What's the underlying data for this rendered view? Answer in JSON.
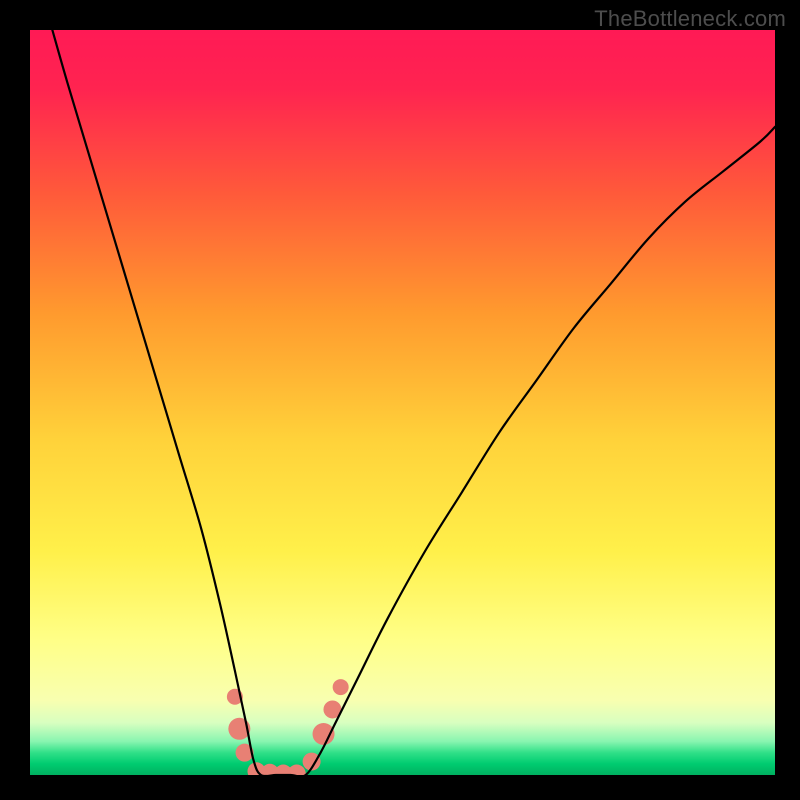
{
  "watermark": "TheBottleneck.com",
  "chart_data": {
    "type": "line",
    "title": "",
    "xlabel": "",
    "ylabel": "",
    "xlim": [
      0,
      1
    ],
    "ylim": [
      0,
      1
    ],
    "background_gradient": {
      "top": "#ff1a4d",
      "upper_mid": "#ff8a2a",
      "mid": "#ffe03a",
      "lower_mid": "#ffff80",
      "green_band": "#00e673",
      "bottom": "#00b359"
    },
    "curve": {
      "description": "Smooth V-shaped bottleneck curve. Falls steeply from top-left, reaches zero around x≈0.30–0.36, rises gently and then steeply toward upper right.",
      "x": [
        0.03,
        0.05,
        0.08,
        0.11,
        0.14,
        0.17,
        0.2,
        0.23,
        0.255,
        0.275,
        0.29,
        0.3,
        0.31,
        0.33,
        0.35,
        0.37,
        0.39,
        0.41,
        0.44,
        0.48,
        0.53,
        0.58,
        0.63,
        0.68,
        0.73,
        0.78,
        0.83,
        0.88,
        0.93,
        0.98,
        1.0
      ],
      "y": [
        1.0,
        0.93,
        0.83,
        0.73,
        0.63,
        0.53,
        0.43,
        0.33,
        0.23,
        0.14,
        0.07,
        0.02,
        0.0,
        0.0,
        0.0,
        0.0,
        0.03,
        0.07,
        0.13,
        0.21,
        0.3,
        0.38,
        0.46,
        0.53,
        0.6,
        0.66,
        0.72,
        0.77,
        0.81,
        0.85,
        0.87
      ]
    },
    "markers": {
      "description": "Salmon-colored circular markers clustered near the curve minimum.",
      "color": "#e88074",
      "points": [
        {
          "x": 0.275,
          "y": 0.105,
          "r": 8
        },
        {
          "x": 0.281,
          "y": 0.062,
          "r": 11
        },
        {
          "x": 0.288,
          "y": 0.03,
          "r": 9
        },
        {
          "x": 0.304,
          "y": 0.005,
          "r": 9
        },
        {
          "x": 0.322,
          "y": 0.003,
          "r": 9
        },
        {
          "x": 0.34,
          "y": 0.002,
          "r": 9
        },
        {
          "x": 0.358,
          "y": 0.002,
          "r": 9
        },
        {
          "x": 0.378,
          "y": 0.018,
          "r": 9
        },
        {
          "x": 0.394,
          "y": 0.055,
          "r": 11
        },
        {
          "x": 0.406,
          "y": 0.088,
          "r": 9
        },
        {
          "x": 0.417,
          "y": 0.118,
          "r": 8
        }
      ]
    }
  }
}
